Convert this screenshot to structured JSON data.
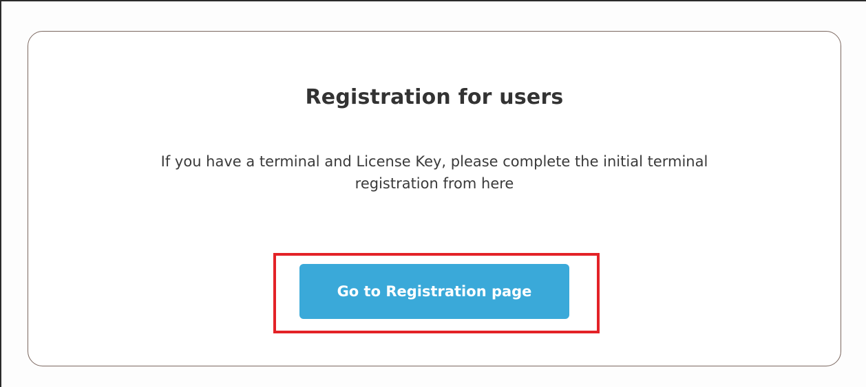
{
  "card": {
    "title": "Registration for users",
    "description_line1": "If you have a terminal and License Key, please complete the initial terminal",
    "description_line2": "registration from here"
  },
  "registration_button": {
    "label": "Go to Registration page"
  },
  "colors": {
    "button_background": "#3aa9d9",
    "highlight_border": "#e32227",
    "card_border": "#7a665e",
    "text": "#333333"
  }
}
